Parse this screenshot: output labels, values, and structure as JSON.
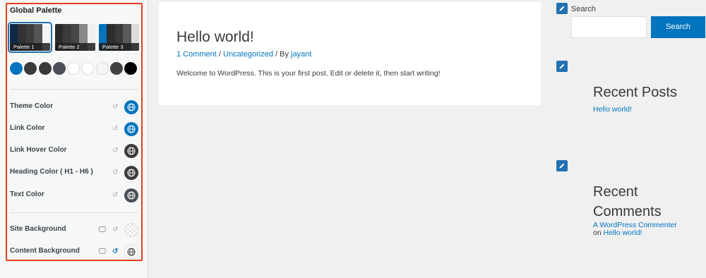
{
  "panel": {
    "title": "Global Palette",
    "palettes": [
      {
        "label": "Palette 1",
        "colors": [
          "#0e2a47",
          "#333333",
          "#3d3d3d",
          "#545454",
          "#f5f5f5"
        ],
        "active": true
      },
      {
        "label": "Palette 2",
        "colors": [
          "#2b2b2b",
          "#3b3b3b",
          "#474747",
          "#888888",
          "#f0f0f0"
        ],
        "active": false
      },
      {
        "label": "Palette 3",
        "colors": [
          "#0274be",
          "#2d2d2d",
          "#3a3a3a",
          "#5a5a5a",
          "#dcdcdc"
        ],
        "active": false
      }
    ],
    "swatches": [
      "#0274be",
      "#3a3a3a",
      "#3a3a3a",
      "#4b4f58",
      "#ffffff",
      "#ffffff",
      "#f5f5f5",
      "#424242",
      "#000000"
    ],
    "color_rows": [
      {
        "label": "Theme Color",
        "color": "#0274be"
      },
      {
        "label": "Link Color",
        "color": "#0274be"
      },
      {
        "label": "Link Hover Color",
        "color": "#3a3a3a"
      },
      {
        "label": "Heading Color ( H1 - H6 )",
        "color": "#3a3a3a"
      },
      {
        "label": "Text Color",
        "color": "#4b4f58"
      }
    ],
    "bg_rows": [
      {
        "label": "Site Background"
      },
      {
        "label": "Content Background"
      }
    ],
    "highlight_color": "#e2401c"
  },
  "post": {
    "title": "Hello world!",
    "meta": {
      "comments": "1 Comment",
      "sep1": " / ",
      "category": "Uncategorized",
      "sep2": " / By ",
      "author": "jayant"
    },
    "body": "Welcome to WordPress. This is your first post. Edit or delete it, then start writing!"
  },
  "sidebar": {
    "search": {
      "label": "Search",
      "placeholder": "",
      "button": "Search"
    },
    "recent_posts": {
      "title": "Recent Posts",
      "items": [
        "Hello world!"
      ]
    },
    "recent_comments": {
      "title_line1": "Recent",
      "title_line2": "Comments",
      "author": "A WordPress Commenter",
      "on": "on ",
      "post": "Hello world!"
    }
  },
  "colors": {
    "accent": "#0274be",
    "admin_blue": "#2271b1",
    "text": "#3a3a3a"
  }
}
